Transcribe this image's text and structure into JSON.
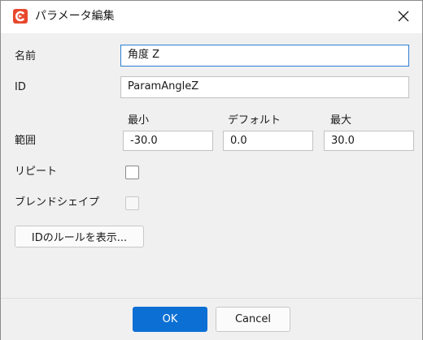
{
  "window": {
    "title": "パラメータ編集",
    "icon": "cubism-logo-icon",
    "accent_color": "#e8482d"
  },
  "form": {
    "name_label": "名前",
    "name_value": "角度 Z",
    "id_label": "ID",
    "id_value": "ParamAngleZ",
    "range_label": "範囲",
    "min_label": "最小",
    "default_label": "デフォルト",
    "max_label": "最大",
    "min_value": "-30.0",
    "default_value": "0.0",
    "max_value": "30.0",
    "repeat_label": "リピート",
    "repeat_checked": false,
    "blend_shape_label": "ブレンドシェイプ",
    "blend_shape_checked": false,
    "id_rules_button": "IDのルールを表示..."
  },
  "footer": {
    "ok_label": "OK",
    "cancel_label": "Cancel",
    "primary_color": "#0b6fd4"
  }
}
